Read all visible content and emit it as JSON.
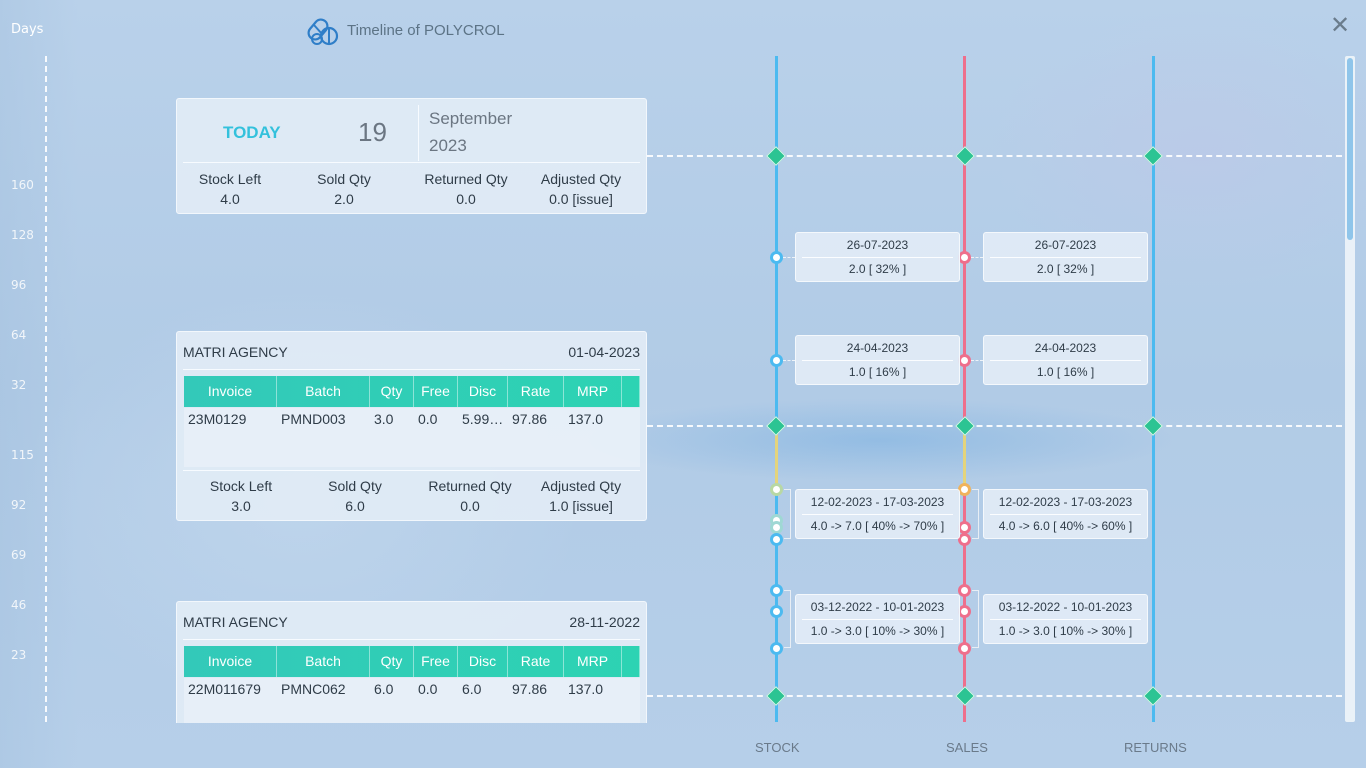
{
  "window": {
    "days_label": "Days",
    "title": "Timeline of POLYCROL",
    "close_glyph": "✕"
  },
  "days_ticks": [
    "160",
    "128",
    "96",
    "64",
    "32",
    "115",
    "92",
    "69",
    "46",
    "23"
  ],
  "today": {
    "label": "TODAY",
    "day": "19",
    "month": "September",
    "year": "2023",
    "stats": [
      {
        "label": "Stock Left",
        "value": "4.0"
      },
      {
        "label": "Sold Qty",
        "value": "2.0"
      },
      {
        "label": "Returned Qty",
        "value": "0.0"
      },
      {
        "label": "Adjusted Qty",
        "value": "0.0 [issue]"
      }
    ]
  },
  "table_headers": [
    "Invoice",
    "Batch",
    "Qty",
    "Free",
    "Disc",
    "Rate",
    "MRP"
  ],
  "purchases": [
    {
      "agency": "MATRI AGENCY",
      "date": "01-04-2023",
      "row": [
        "23M0129",
        "PMND003",
        "3.0",
        "0.0",
        "5.998...",
        "97.86",
        "137.0"
      ],
      "stats": [
        {
          "label": "Stock Left",
          "value": "3.0"
        },
        {
          "label": "Sold Qty",
          "value": "6.0"
        },
        {
          "label": "Returned Qty",
          "value": "0.0"
        },
        {
          "label": "Adjusted Qty",
          "value": "1.0 [issue]"
        }
      ]
    },
    {
      "agency": "MATRI AGENCY",
      "date": "28-11-2022",
      "row": [
        "22M011679",
        "PMNC062",
        "6.0",
        "0.0",
        "6.0",
        "97.86",
        "137.0"
      ]
    }
  ],
  "events": {
    "stock": [
      {
        "date": "26-07-2023",
        "value": "2.0 [ 32% ]"
      },
      {
        "date": "24-04-2023",
        "value": "1.0 [ 16% ]"
      },
      {
        "date": "12-02-2023 - 17-03-2023",
        "value": "4.0 -> 7.0 [ 40% -> 70% ]"
      },
      {
        "date": "03-12-2022 - 10-01-2023",
        "value": "1.0 -> 3.0 [ 10% -> 30% ]"
      }
    ],
    "sales": [
      {
        "date": "26-07-2023",
        "value": "2.0 [ 32% ]"
      },
      {
        "date": "24-04-2023",
        "value": "1.0 [ 16% ]"
      },
      {
        "date": "12-02-2023 - 17-03-2023",
        "value": "4.0 -> 6.0 [ 40% -> 60% ]"
      },
      {
        "date": "03-12-2022 - 10-01-2023",
        "value": "1.0 -> 3.0 [ 10% -> 30% ]"
      }
    ]
  },
  "axis_labels": {
    "stock": "STOCK",
    "sales": "SALES",
    "returns": "RETURNS"
  },
  "colors": {
    "stock_line": "#4cbaf0",
    "sales_line": "#ee6f8c",
    "returns_line": "#4cbaf0",
    "table_header": "#2dd3b3",
    "today_label": "#33c1dc"
  }
}
